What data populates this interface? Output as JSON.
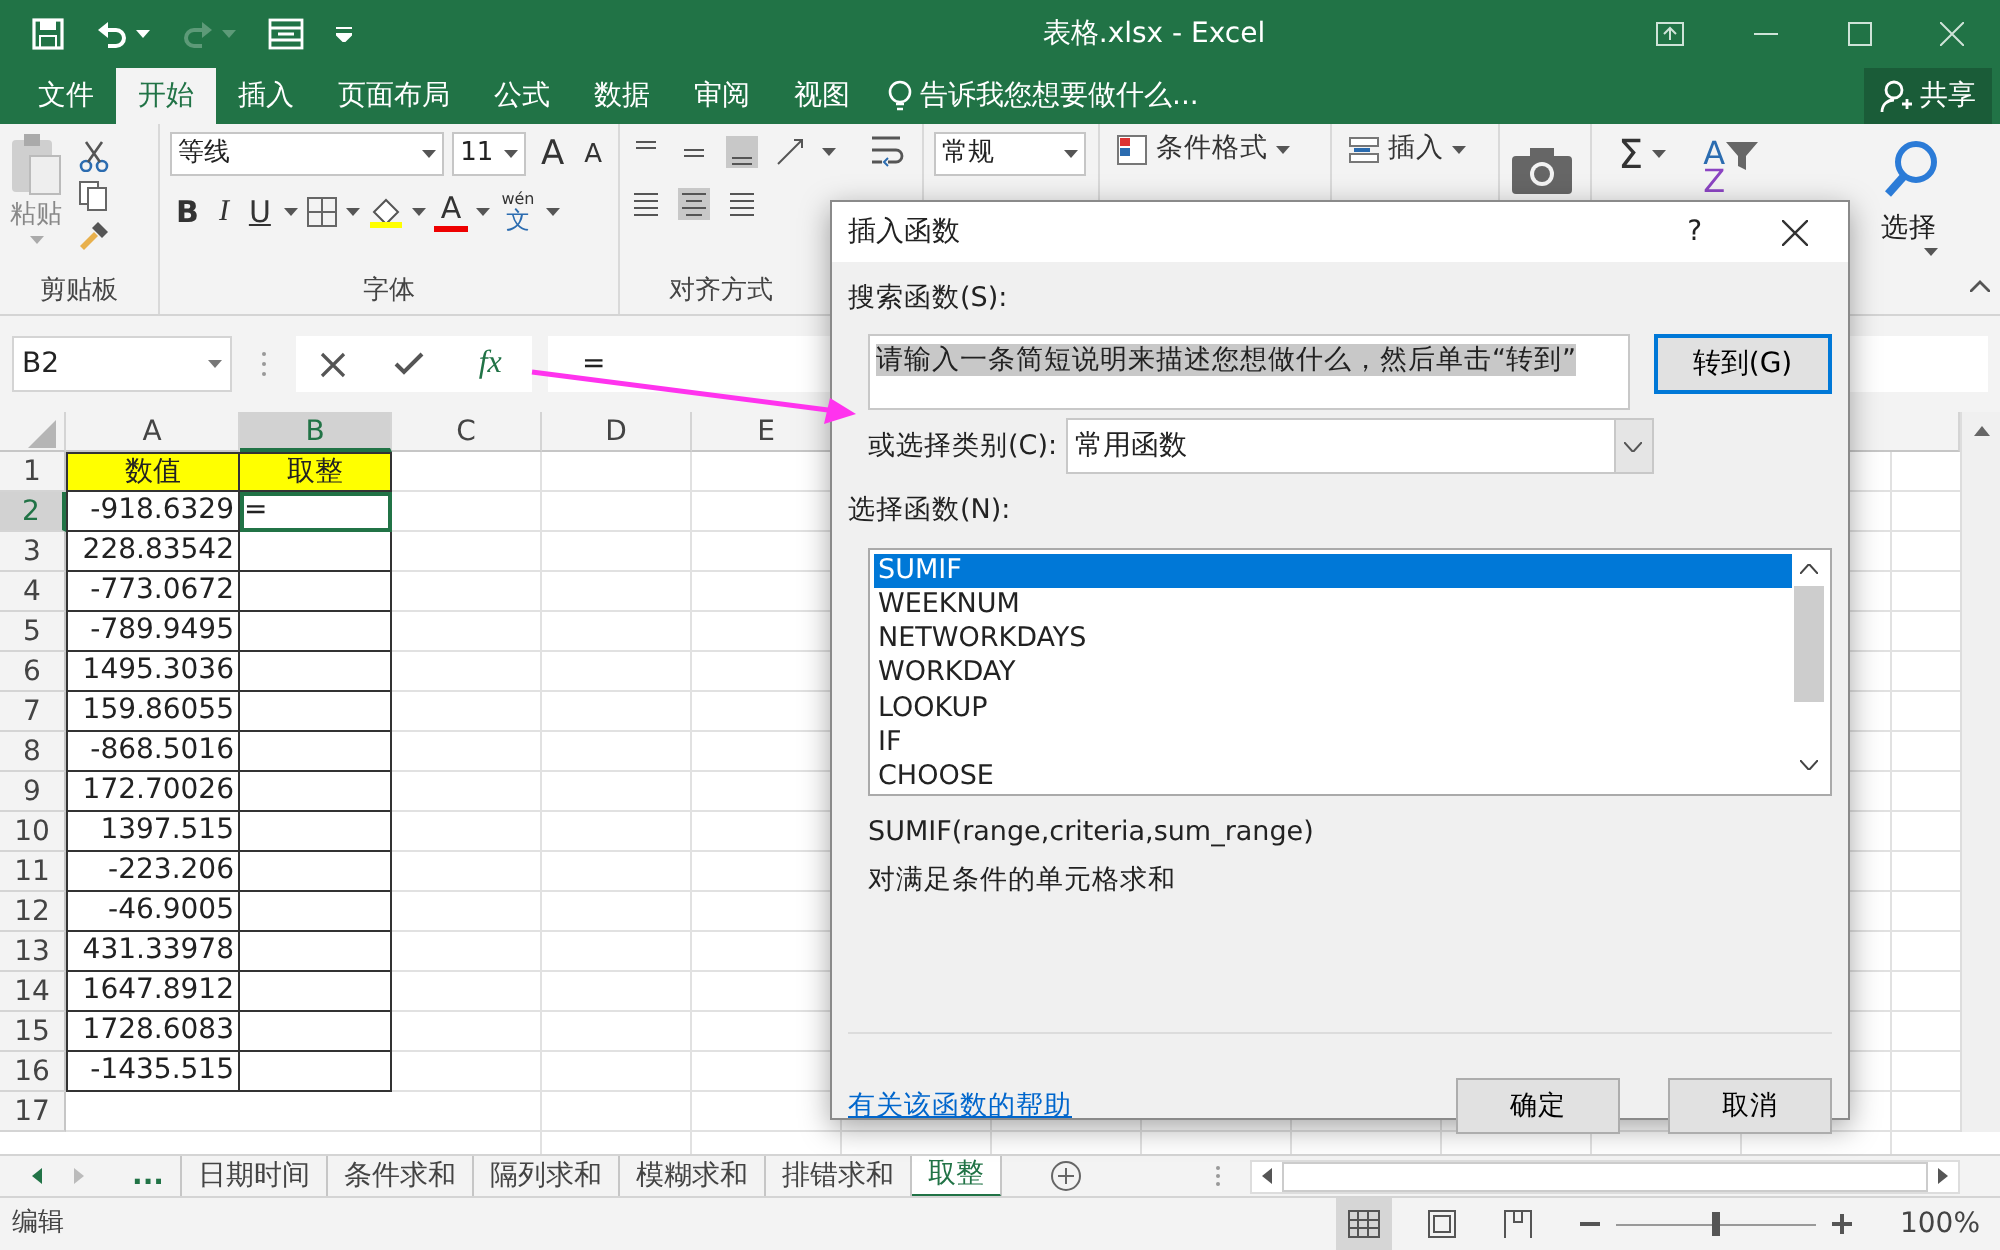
{
  "window": {
    "title": "表格.xlsx - Excel"
  },
  "ribbon_tabs": [
    {
      "label": "文件",
      "selected": false
    },
    {
      "label": "开始",
      "selected": true
    },
    {
      "label": "插入",
      "selected": false
    },
    {
      "label": "页面布局",
      "selected": false
    },
    {
      "label": "公式",
      "selected": false
    },
    {
      "label": "数据",
      "selected": false
    },
    {
      "label": "审阅",
      "selected": false
    },
    {
      "label": "视图",
      "selected": false
    }
  ],
  "tell_me": "告诉我您想要做什么...",
  "share": "共享",
  "ribbon": {
    "paste": "粘贴",
    "font_name": "等线",
    "font_size": "11",
    "grow_font": "A",
    "shrink_font": "A",
    "bold": "B",
    "italic": "I",
    "underline": "U",
    "font_color": "A",
    "phonetic": [
      "wén",
      "文"
    ],
    "number_format": "常规",
    "conditional_format": "条件格式",
    "insert_cells": "插入",
    "autosum": "Σ",
    "sort_letters": [
      "A",
      "Z"
    ],
    "find_select": "选择",
    "group_labels": [
      "剪贴板",
      "字体",
      "对齐方式"
    ]
  },
  "formula_bar": {
    "name_box": "B2",
    "fx": "fx",
    "formula": "="
  },
  "sheet": {
    "columns": [
      {
        "label": "A",
        "selected": false
      },
      {
        "label": "B",
        "selected": true
      },
      {
        "label": "C",
        "selected": false
      },
      {
        "label": "D",
        "selected": false
      },
      {
        "label": "E",
        "selected": false
      }
    ],
    "rows": [
      {
        "number": "1",
        "selected": false,
        "cells": [
          "数值",
          "取整"
        ],
        "header": true
      },
      {
        "number": "2",
        "selected": true,
        "cells": [
          "-918.6329",
          "="
        ],
        "header": false
      },
      {
        "number": "3",
        "selected": false,
        "cells": [
          "228.83542",
          ""
        ],
        "header": false
      },
      {
        "number": "4",
        "selected": false,
        "cells": [
          "-773.0672",
          ""
        ],
        "header": false
      },
      {
        "number": "5",
        "selected": false,
        "cells": [
          "-789.9495",
          ""
        ],
        "header": false
      },
      {
        "number": "6",
        "selected": false,
        "cells": [
          "1495.3036",
          ""
        ],
        "header": false
      },
      {
        "number": "7",
        "selected": false,
        "cells": [
          "159.86055",
          ""
        ],
        "header": false
      },
      {
        "number": "8",
        "selected": false,
        "cells": [
          "-868.5016",
          ""
        ],
        "header": false
      },
      {
        "number": "9",
        "selected": false,
        "cells": [
          "172.70026",
          ""
        ],
        "header": false
      },
      {
        "number": "10",
        "selected": false,
        "cells": [
          "1397.515",
          ""
        ],
        "header": false
      },
      {
        "number": "11",
        "selected": false,
        "cells": [
          "-223.206",
          ""
        ],
        "header": false
      },
      {
        "number": "12",
        "selected": false,
        "cells": [
          "-46.9005",
          ""
        ],
        "header": false
      },
      {
        "number": "13",
        "selected": false,
        "cells": [
          "431.33978",
          ""
        ],
        "header": false
      },
      {
        "number": "14",
        "selected": false,
        "cells": [
          "1647.8912",
          ""
        ],
        "header": false
      },
      {
        "number": "15",
        "selected": false,
        "cells": [
          "1728.6083",
          ""
        ],
        "header": false
      },
      {
        "number": "16",
        "selected": false,
        "cells": [
          "-1435.515",
          ""
        ],
        "header": false
      },
      {
        "number": "17",
        "selected": false,
        "cells": [
          "",
          ""
        ],
        "header": false
      }
    ]
  },
  "sheet_tabs": {
    "more": "...",
    "tabs": [
      {
        "label": "日期时间",
        "selected": false
      },
      {
        "label": "条件求和",
        "selected": false
      },
      {
        "label": "隔列求和",
        "selected": false
      },
      {
        "label": "模糊求和",
        "selected": false
      },
      {
        "label": "排错求和",
        "selected": false
      },
      {
        "label": "取整",
        "selected": true
      }
    ]
  },
  "status_bar": {
    "mode": "编辑",
    "zoom": "100%",
    "zoom_slider": {
      "level": 0.5
    }
  },
  "dialog": {
    "title": "插入函数",
    "help": "?",
    "search_label": "搜索函数(S):",
    "search_value": "请输入一条简短说明来描述您想做什么，然后单击“转到”",
    "go_button": "转到(G)",
    "category_label": "或选择类别(C):",
    "category": "常用函数",
    "list_label": "选择函数(N):",
    "functions": [
      {
        "name": "SUMIF",
        "selected": true
      },
      {
        "name": "WEEKNUM",
        "selected": false
      },
      {
        "name": "NETWORKDAYS",
        "selected": false
      },
      {
        "name": "WORKDAY",
        "selected": false
      },
      {
        "name": "LOOKUP",
        "selected": false
      },
      {
        "name": "IF",
        "selected": false
      },
      {
        "name": "CHOOSE",
        "selected": false
      }
    ],
    "signature": "SUMIF(range,criteria,sum_range)",
    "description": "对满足条件的单元格求和",
    "help_link": "有关该函数的帮助",
    "buttons": [
      "确定",
      "取消"
    ]
  }
}
